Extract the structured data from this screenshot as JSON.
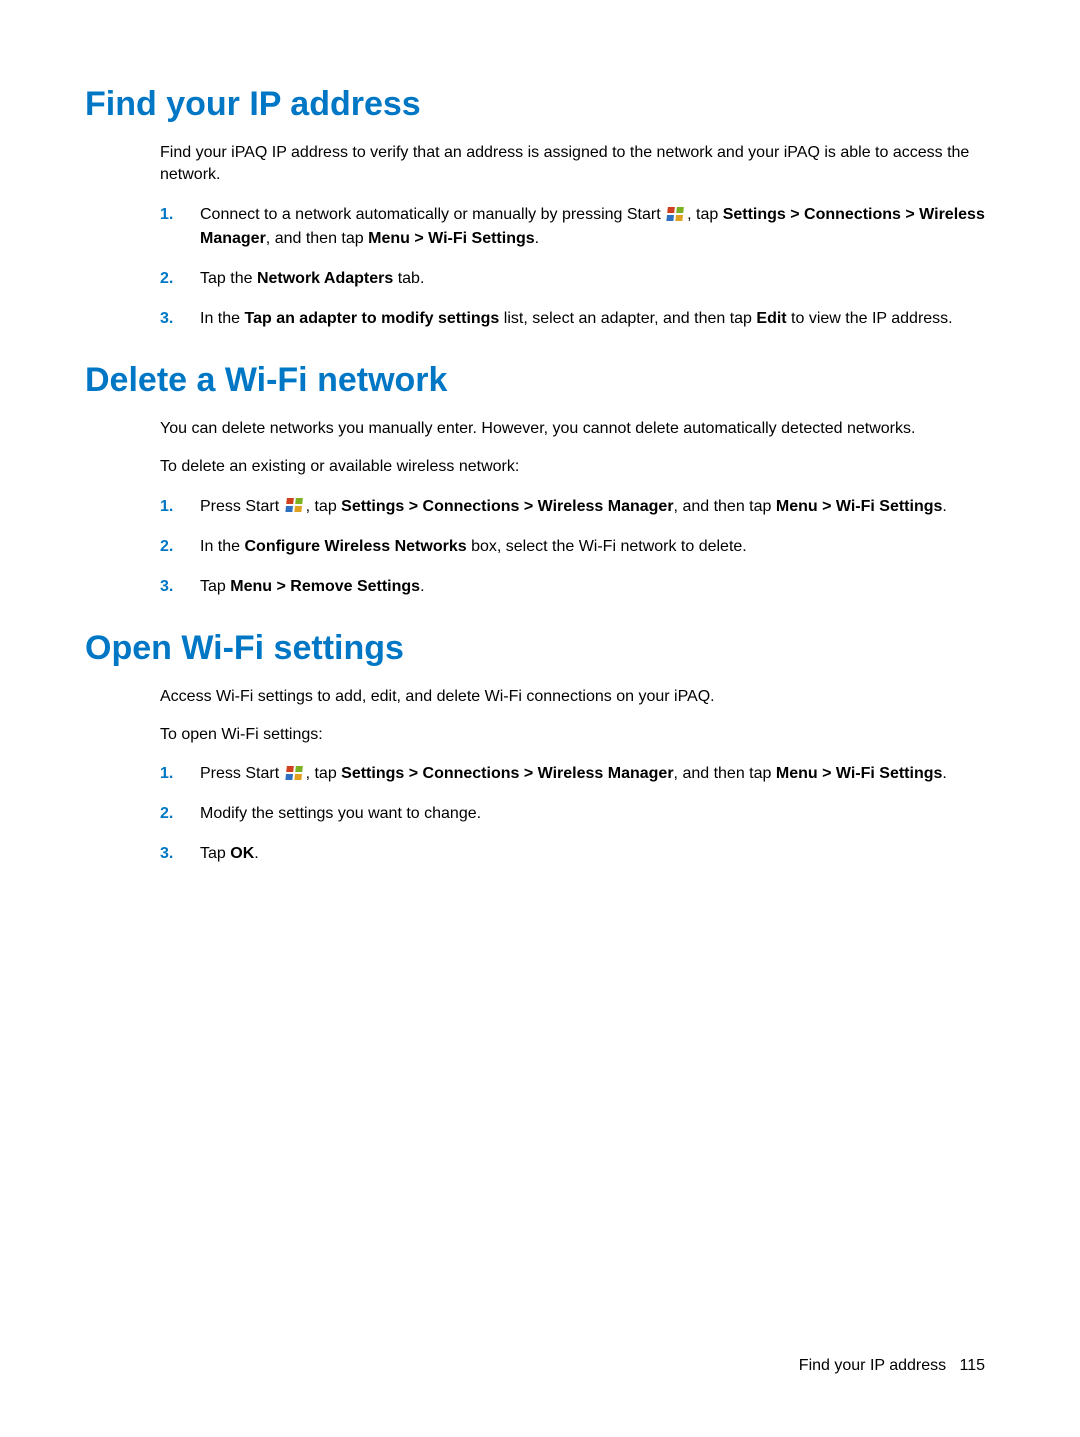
{
  "section1": {
    "heading": "Find your IP address",
    "intro": "Find your iPAQ IP address to verify that an address is assigned to the network and your iPAQ is able to access the network.",
    "steps": {
      "s1": {
        "num": "1.",
        "pre": "Connect to a network automatically or manually by pressing Start ",
        "post": ", tap ",
        "b1": "Settings > Connections > Wireless Manager",
        "mid2": ", and then tap ",
        "b2": "Menu > Wi-Fi Settings",
        "end": "."
      },
      "s2": {
        "num": "2.",
        "pre": "Tap the ",
        "b1": "Network Adapters",
        "post": " tab."
      },
      "s3": {
        "num": "3.",
        "pre": "In the ",
        "b1": "Tap an adapter to modify settings",
        "mid": " list, select an adapter, and then tap ",
        "b2": "Edit",
        "post": " to view the IP address."
      }
    }
  },
  "section2": {
    "heading": "Delete a Wi-Fi network",
    "intro": "You can delete networks you manually enter. However, you cannot delete automatically detected networks.",
    "intro2": "To delete an existing or available wireless network:",
    "steps": {
      "s1": {
        "num": "1.",
        "pre": "Press Start ",
        "post1": ", tap ",
        "b1": "Settings > Connections > Wireless Manager",
        "mid": ", and then tap ",
        "b2": "Menu > Wi-Fi Settings",
        "end": "."
      },
      "s2": {
        "num": "2.",
        "pre": "In the ",
        "b1": "Configure Wireless Networks",
        "post": " box, select the Wi-Fi network to delete."
      },
      "s3": {
        "num": "3.",
        "pre": "Tap ",
        "b1": "Menu > Remove Settings",
        "post": "."
      }
    }
  },
  "section3": {
    "heading": "Open Wi-Fi settings",
    "intro": "Access Wi-Fi settings to add, edit, and delete Wi-Fi connections on your iPAQ.",
    "intro2": "To open Wi-Fi settings:",
    "steps": {
      "s1": {
        "num": "1.",
        "pre": "Press Start ",
        "post1": ", tap ",
        "b1": "Settings > Connections > Wireless Manager",
        "mid": ", and then tap ",
        "b2": "Menu > Wi-Fi Settings",
        "end": "."
      },
      "s2": {
        "num": "2.",
        "text": "Modify the settings you want to change."
      },
      "s3": {
        "num": "3.",
        "pre": "Tap ",
        "b1": "OK",
        "post": "."
      }
    }
  },
  "footer": {
    "text": "Find your IP address",
    "page": "115"
  }
}
